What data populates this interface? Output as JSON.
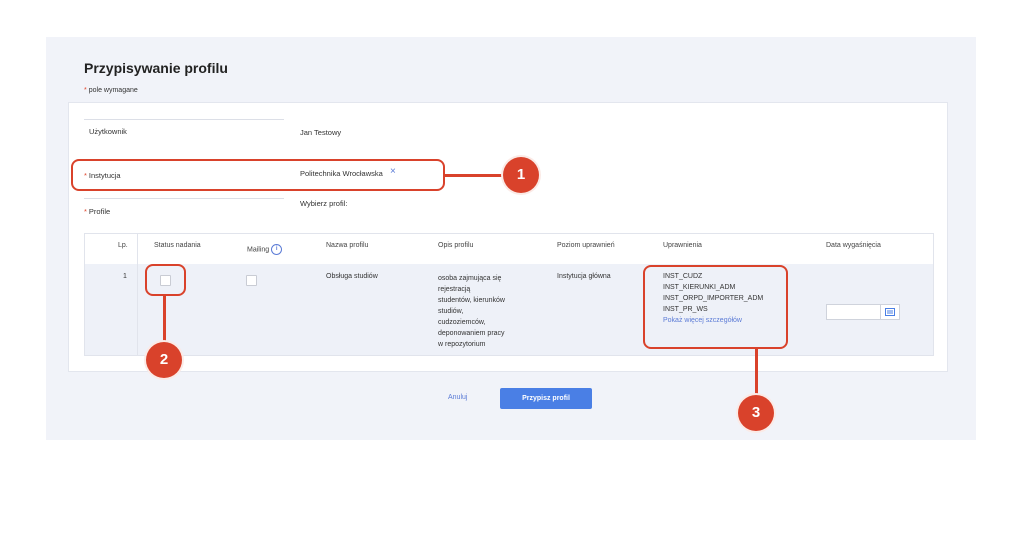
{
  "page": {
    "title": "Przypisywanie profilu",
    "required_note": "pole wymagane",
    "required_star": "*"
  },
  "form": {
    "user_label": "Użytkownik",
    "user_value": "Jan Testowy",
    "institution_label": "Instytucja",
    "institution_value": "Politechnika Wrocławska",
    "clear_icon": "×",
    "profiles_label": "Profile",
    "profiles_prompt": "Wybierz profil:"
  },
  "table": {
    "headers": [
      "Lp.",
      "Status nadania",
      "Mailing",
      "Nazwa profilu",
      "Opis profilu",
      "Poziom uprawnień",
      "Uprawnienia",
      "Data wygaśnięcia"
    ],
    "info_icon": "i",
    "rows": [
      {
        "lp": "1",
        "status_checked": false,
        "mailing_checked": false,
        "name": "Obsługa studiów",
        "description": [
          "osoba zajmująca się",
          "rejestracją",
          "studentów, kierunków",
          "studiów,",
          "cudzoziemców,",
          "deponowaniem pracy",
          "w repozytorium"
        ],
        "level": "Instytucja główna",
        "permissions": [
          "INST_CUDZ",
          "INST_KIERUNKI_ADM",
          "INST_ORPD_IMPORTER_ADM",
          "INST_PR_WS"
        ],
        "more_link": "Pokaż więcej szczegółów",
        "expiry_date": ""
      }
    ]
  },
  "actions": {
    "cancel": "Anuluj",
    "submit": "Przypisz profil"
  },
  "callouts": [
    "1",
    "2",
    "3"
  ],
  "colors": {
    "accent": "#4a7fe5",
    "callout": "#d9422b",
    "required": "#e0442a"
  }
}
